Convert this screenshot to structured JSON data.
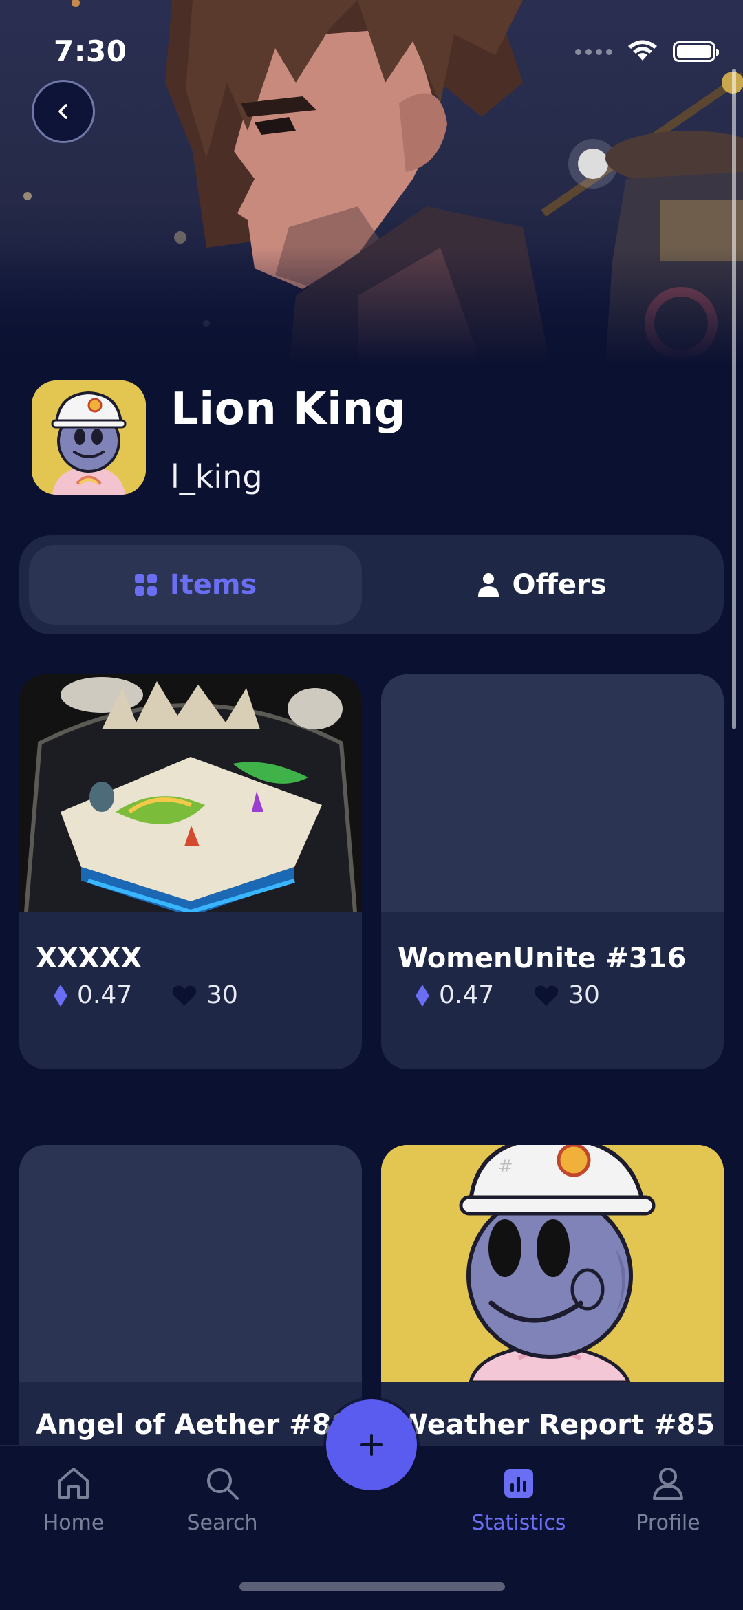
{
  "status_bar": {
    "time": "7:30"
  },
  "profile": {
    "name": "Lion King",
    "handle": "l_king"
  },
  "tabs": [
    {
      "label": "Items",
      "icon": "grid-icon",
      "active": true
    },
    {
      "label": "Offers",
      "icon": "person-icon",
      "active": false
    }
  ],
  "items": [
    {
      "title": "XXXXX",
      "price": "0.47",
      "likes": "30",
      "image": "floating-island-art"
    },
    {
      "title": "WomenUnite #316",
      "price": "0.47",
      "likes": "30",
      "image": "placeholder"
    },
    {
      "title": "Angel of Aether #88",
      "image": "placeholder"
    },
    {
      "title": "Weather Report #85",
      "image": "hardhat-character-art"
    }
  ],
  "nav": {
    "home": "Home",
    "search": "Search",
    "statistics": "Statistics",
    "profile": "Profile",
    "active": "Statistics"
  },
  "colors": {
    "background": "#0b1131",
    "card": "#1f2746",
    "accent": "#5a5cf0",
    "accent_text": "#6a6ef2"
  }
}
